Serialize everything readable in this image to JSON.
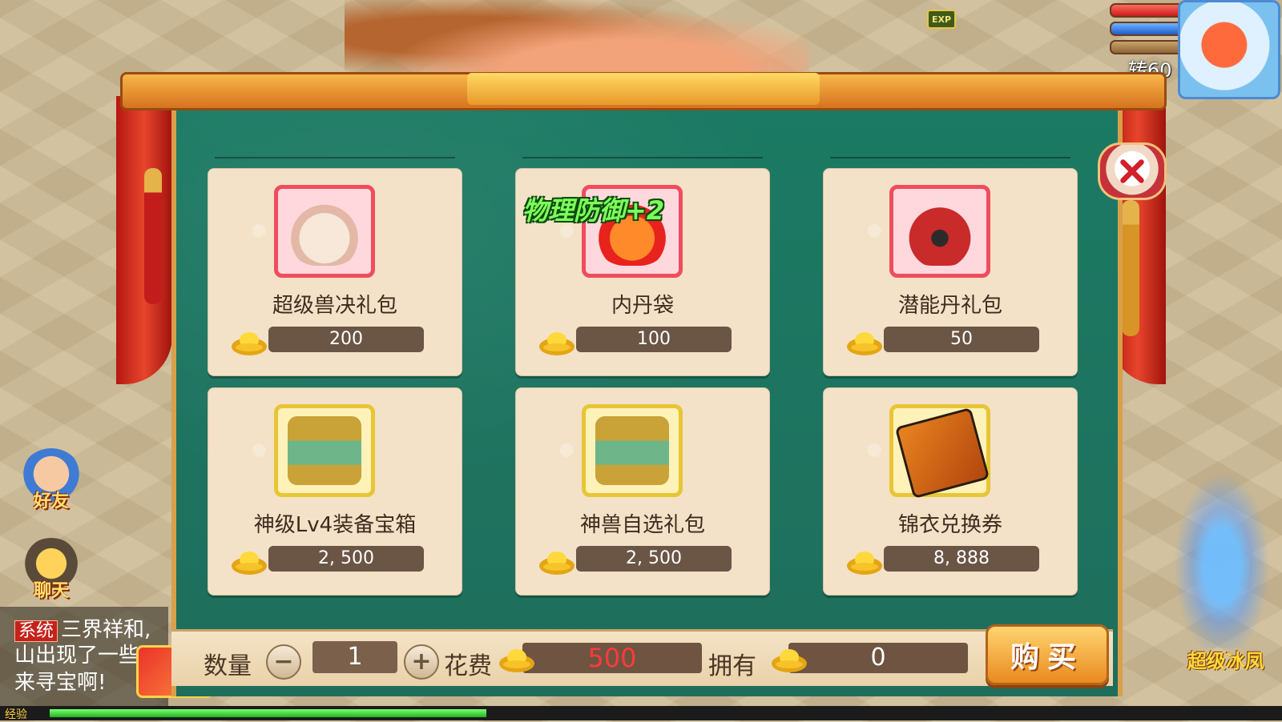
{
  "hud": {
    "exp_badge": "EXP",
    "level_text": "转60"
  },
  "side": {
    "friends_label": "好友",
    "chat_label": "聊天"
  },
  "chat_log": {
    "tag": "系统",
    "line1": "三界祥和,",
    "line2": "山出现了一些",
    "line3": "来寻宝啊!"
  },
  "exp_strip_label": "经验",
  "pet_label": "超级冰凤",
  "items": [
    {
      "name": "超级兽决礼包",
      "price": "200",
      "frame": "red",
      "art_color": "#f2d9c8"
    },
    {
      "name": "内丹袋",
      "price": "100",
      "frame": "red",
      "art_color": "#ff5a2a"
    },
    {
      "name": "潜能丹礼包",
      "price": "50",
      "frame": "red",
      "art_color": "#c92a2a"
    },
    {
      "name": "神级Lv4装备宝箱",
      "price": "2, 500",
      "frame": "gold",
      "art_color": "#e0a83a"
    },
    {
      "name": "神兽自选礼包",
      "price": "2, 500",
      "frame": "gold",
      "art_color": "#e0a83a"
    },
    {
      "name": "锦衣兑换券",
      "price": "8, 888",
      "frame": "gold",
      "art_color": "#e6731f"
    }
  ],
  "buff_popup": "物理防御+2",
  "purchase": {
    "quantity_label": "数量",
    "quantity_value": "1",
    "cost_label": "花费",
    "cost_value": "500",
    "owned_label": "拥有",
    "owned_value": "0",
    "buy_label": "购买"
  },
  "colors": {
    "panel_green": "#1b7a63",
    "card_bg": "#f3e2c7",
    "price_bg": "#6b5545",
    "cost_red": "#ff3b3b",
    "buy_orange": "#e98a1f"
  }
}
